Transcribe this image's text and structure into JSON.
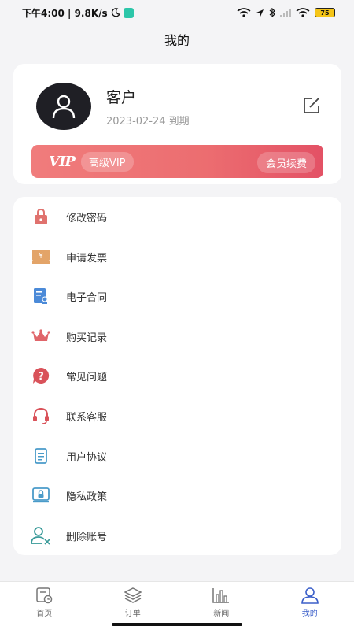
{
  "status_bar": {
    "time_speed": "下午4:00 | 9.8K/s",
    "battery": "75"
  },
  "header": {
    "title": "我的"
  },
  "profile": {
    "name": "客户",
    "expiry": "2023-02-24 到期",
    "vip_logo": "VIP",
    "vip_level": "高级VIP",
    "renew_label": "会员续费"
  },
  "menu": {
    "items": [
      {
        "label": "修改密码",
        "icon": "lock-icon"
      },
      {
        "label": "申请发票",
        "icon": "invoice-icon"
      },
      {
        "label": "电子合同",
        "icon": "contract-icon"
      },
      {
        "label": "购买记录",
        "icon": "crown-icon"
      },
      {
        "label": "常见问题",
        "icon": "question-icon"
      },
      {
        "label": "联系客服",
        "icon": "headset-icon"
      },
      {
        "label": "用户协议",
        "icon": "agreement-icon"
      },
      {
        "label": "隐私政策",
        "icon": "privacy-icon"
      },
      {
        "label": "删除账号",
        "icon": "delete-user-icon"
      }
    ]
  },
  "tabs": [
    {
      "label": "首页",
      "icon": "home-icon"
    },
    {
      "label": "订单",
      "icon": "layers-icon"
    },
    {
      "label": "新闻",
      "icon": "chart-icon"
    },
    {
      "label": "我的",
      "icon": "user-icon",
      "active": true
    }
  ],
  "colors": {
    "accent": "#3b5fc9",
    "vip_gradient_start": "#f07c7c",
    "vip_gradient_end": "#e35165",
    "background": "#f4f4f6"
  }
}
